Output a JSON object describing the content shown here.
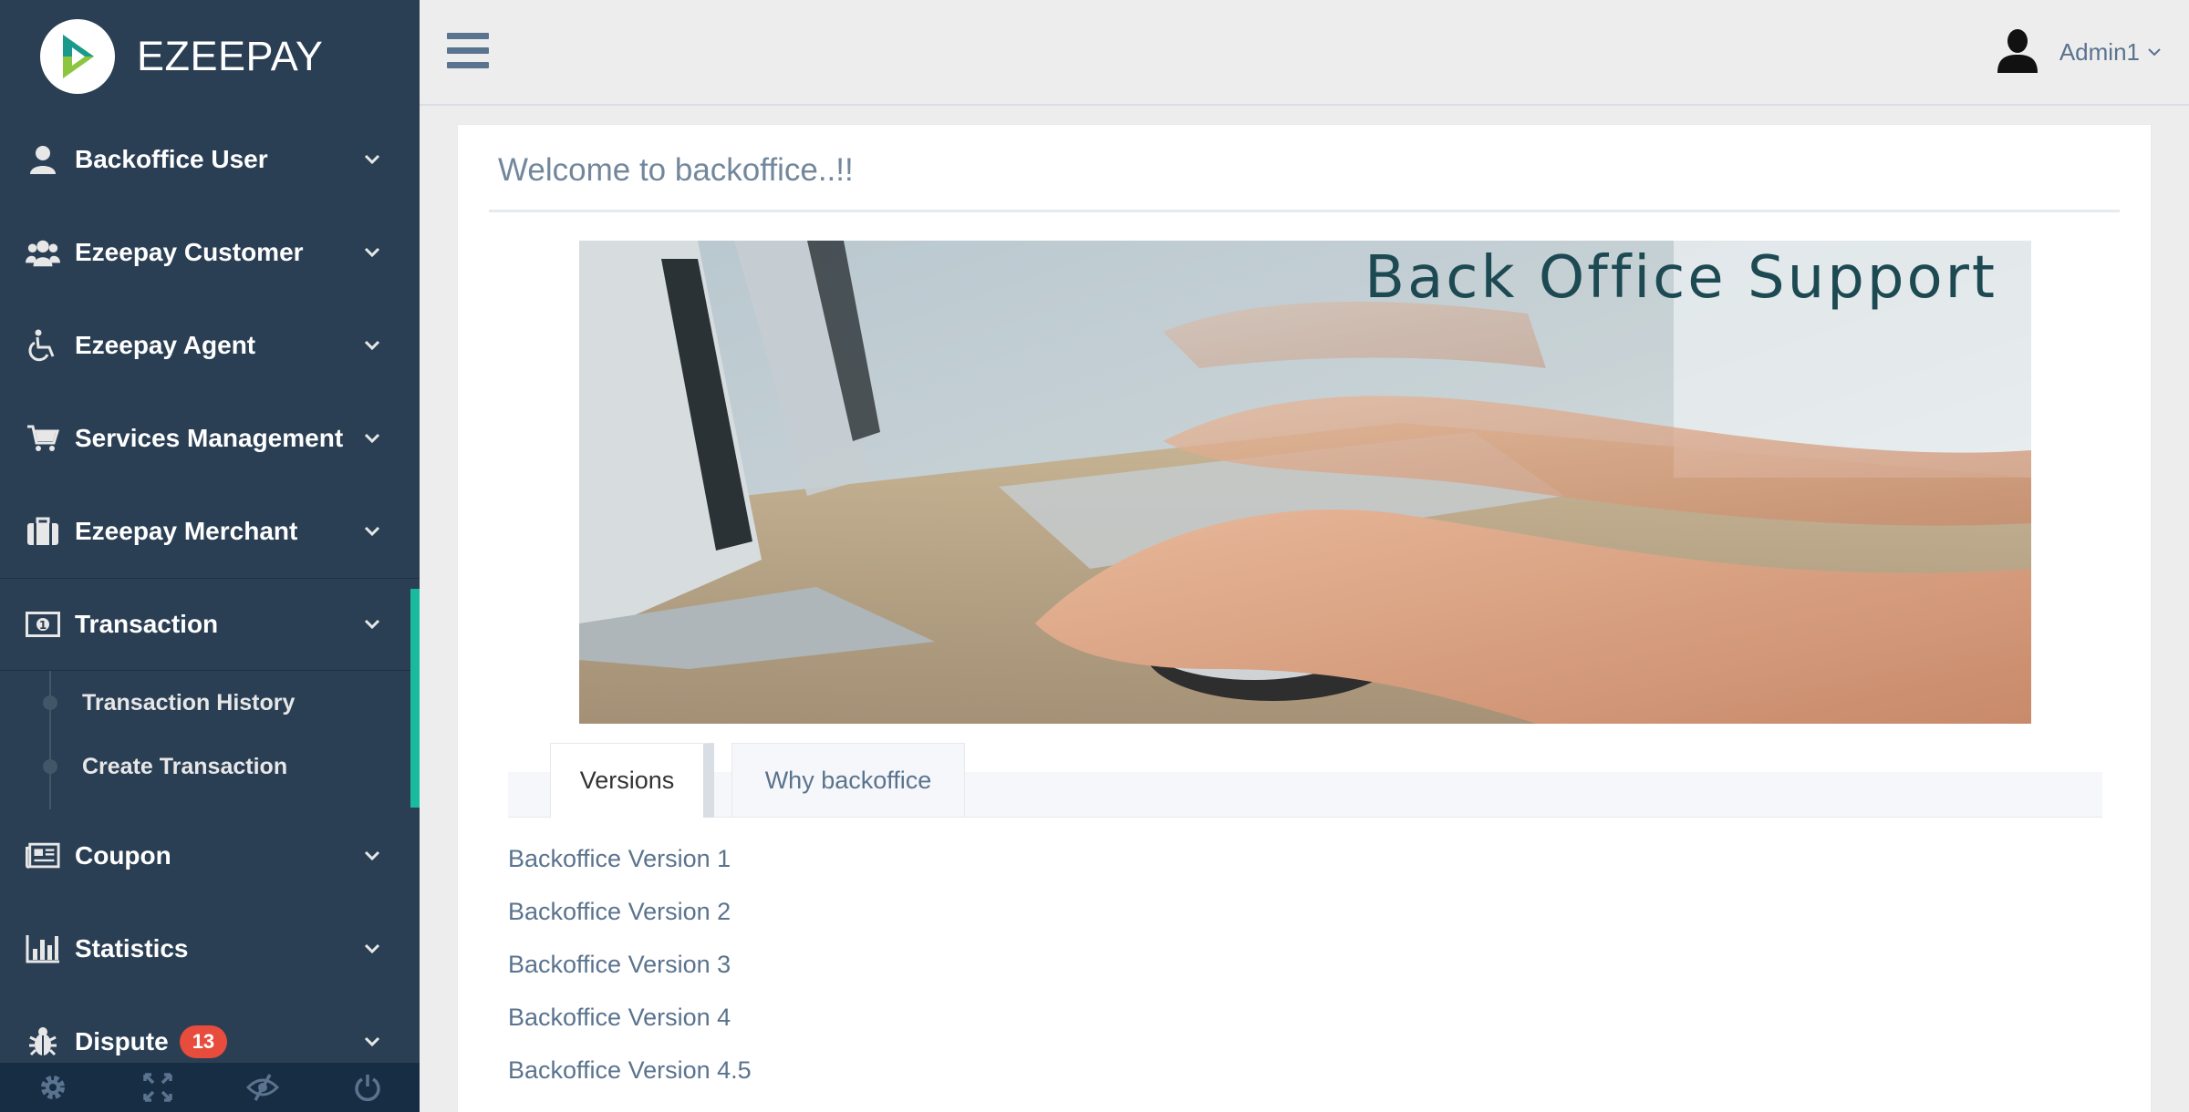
{
  "brand": {
    "name": "EZEEPAY"
  },
  "sidebar": {
    "items": [
      {
        "label": "Backoffice User",
        "icon": "user-icon"
      },
      {
        "label": "Ezeepay Customer",
        "icon": "users-icon"
      },
      {
        "label": "Ezeepay Agent",
        "icon": "wheelchair-icon"
      },
      {
        "label": "Services Management",
        "icon": "cart-icon"
      },
      {
        "label": "Ezeepay Merchant",
        "icon": "briefcase-icon"
      },
      {
        "label": "Transaction",
        "icon": "money-icon",
        "active": true
      },
      {
        "label": "Coupon",
        "icon": "newspaper-icon"
      },
      {
        "label": "Statistics",
        "icon": "bar-chart-icon"
      },
      {
        "label": "Dispute",
        "icon": "bug-icon",
        "badge": "13"
      }
    ],
    "submenu": [
      "Transaction History",
      "Create Transaction"
    ],
    "footer_icons": [
      "settings-icon",
      "fullscreen-icon",
      "eye-slash-icon",
      "power-icon"
    ]
  },
  "topnav": {
    "user_name": "Admin1"
  },
  "main": {
    "title": "Welcome to backoffice..!!",
    "banner_text": "Back Office Support",
    "tabs": [
      {
        "label": "Versions",
        "active": true
      },
      {
        "label": "Why backoffice",
        "active": false
      }
    ],
    "versions": [
      "Backoffice Version 1",
      "Backoffice Version 2",
      "Backoffice Version 3",
      "Backoffice Version 4",
      "Backoffice Version 4.5"
    ]
  },
  "colors": {
    "sidebar_bg": "#2a3f54",
    "accent_green": "#1abb9c",
    "badge_red": "#e74c3c",
    "link_text": "#5a738e"
  }
}
